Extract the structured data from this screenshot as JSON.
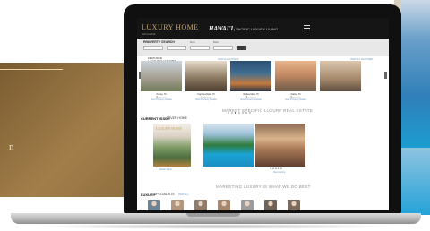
{
  "backdrop": {
    "left_text": "n"
  },
  "site": {
    "logo": "LUXURY HOME",
    "logo_sub": "MAGAZINE",
    "edition": "HAWAI'I",
    "edition_sub": "| PACIFIC LUXURY LIVING"
  },
  "search": {
    "title": "PROPERTY SEARCH",
    "fields": [
      {
        "label": "Location",
        "value": ""
      },
      {
        "label": "Price",
        "value": ""
      },
      {
        "label": "Beds",
        "value": ""
      },
      {
        "label": "Baths",
        "value": ""
      }
    ],
    "button": "Search"
  },
  "featured": {
    "label": "FEATURED",
    "title": "LUXURY HOMES",
    "middle_link": "VIEW ALL LISTINGS",
    "right_link": "VIEW ALL FEATURED",
    "cards": [
      {
        "name": "Kailua, HI",
        "price": "$ —,—,—",
        "link": "View Property Details",
        "color": "#b9c7d3"
      },
      {
        "name": "Kapalua Maui, HI",
        "price": "$ —,—,—",
        "link": "View Property Details",
        "color": "#8d7a62"
      },
      {
        "name": "Wailea Maui, HI",
        "price": "$ —,—,—",
        "link": "View Property Details",
        "color": "#3f6f93"
      },
      {
        "name": "Kailua, HI",
        "price": "$ —,—,—",
        "link": "View Property Details",
        "color": "#c58a63"
      }
    ],
    "dots": 7,
    "active_dot": 2
  },
  "headline_market": "MARKET SPECIFIC LUXURY REAL ESTATE",
  "current_issue": {
    "label": "CURRENT ISSUE",
    "title": "COVER HOME",
    "cover_logo": "LUXURY HOME",
    "cover_link": "Read Online",
    "photo_caption": "View Listing",
    "rating_text": "★ ★ ★ ★ ★"
  },
  "headline_marketing": "MARKETING LUXURY IS WHAT WE DO BEST",
  "specialists": {
    "label": "LUXURY",
    "title": "SPECIALISTS",
    "link": "VIEW ALL",
    "people": [
      "#6f8292",
      "#b1977f",
      "#8f7c6d",
      "#a4876f",
      "#9b9b9b",
      "#6f6358",
      "#7a6a5d"
    ]
  },
  "colors": {
    "gold": "#c9a665",
    "header": "#151515",
    "pool": "#1c9fd2"
  }
}
